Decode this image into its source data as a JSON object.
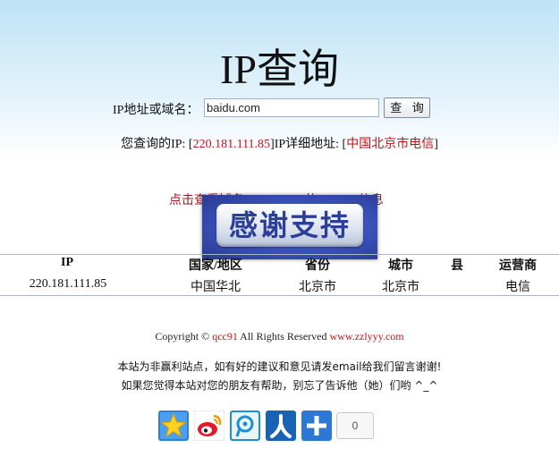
{
  "page": {
    "title": "IP查询"
  },
  "search": {
    "label": "IP地址或域名：",
    "value": "baidu.com",
    "button": "查 询"
  },
  "result": {
    "prefix": "您查询的IP: [",
    "ip": "220.181.111.85",
    "middle": "]IP详细地址: [",
    "location": "中国北京市电信",
    "suffix": "]"
  },
  "lookup_link": "点击查看域名(baidu.com)的WHOIS信息",
  "banner": {
    "text": "感谢支持"
  },
  "table": {
    "headers": [
      "IP",
      "国家/地区",
      "省份",
      "城市",
      "县",
      "运营商"
    ],
    "row": [
      "220.181.111.85",
      "中国华北",
      "北京市",
      "北京市",
      "",
      "电信"
    ]
  },
  "footer": {
    "copyright_prefix": "Copyright © ",
    "author": "qcc91",
    "rights": " All Rights Reserved ",
    "site": "www.zzlyyy.com",
    "note1": "本站为非赢利站点，如有好的建议和意见请发email给我们留言谢谢!",
    "note2": "如果您觉得本站对您的朋友有帮助，别忘了告诉他（她）们哟 ^_^"
  },
  "share": {
    "count": "0",
    "icons": [
      "qzone-icon",
      "weibo-icon",
      "tencent-weibo-icon",
      "renren-icon",
      "more-share-icon"
    ]
  },
  "colors": {
    "accent_red": "#c0141a",
    "link_dark_red": "#9a1b1b",
    "banner_blue": "#3850b8"
  }
}
